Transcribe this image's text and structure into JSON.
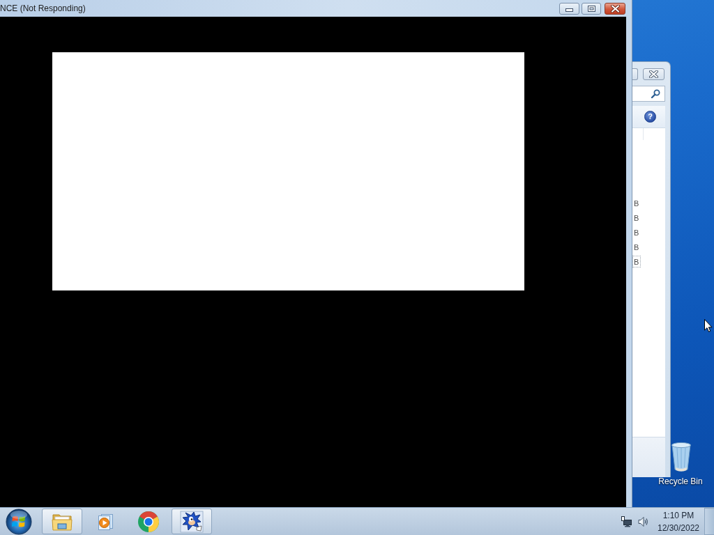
{
  "main_window": {
    "title": "NCE (Not Responding)"
  },
  "background_window": {
    "help_label": "?",
    "list_items": [
      {
        "text": "B",
        "focused": false
      },
      {
        "text": "B",
        "focused": false
      },
      {
        "text": "B",
        "focused": false
      },
      {
        "text": "B",
        "focused": false
      },
      {
        "text": "B",
        "focused": true
      }
    ]
  },
  "desktop_icons": [
    {
      "label": "Recycle Bin"
    }
  ],
  "taskbar": {
    "items": [
      {
        "kind": "explorer",
        "running": true
      },
      {
        "kind": "media_player",
        "running": false
      },
      {
        "kind": "browser",
        "running": false
      },
      {
        "kind": "game",
        "running": true
      }
    ]
  },
  "tray": {
    "time": "1:10 PM",
    "date": "12/30/2022"
  }
}
